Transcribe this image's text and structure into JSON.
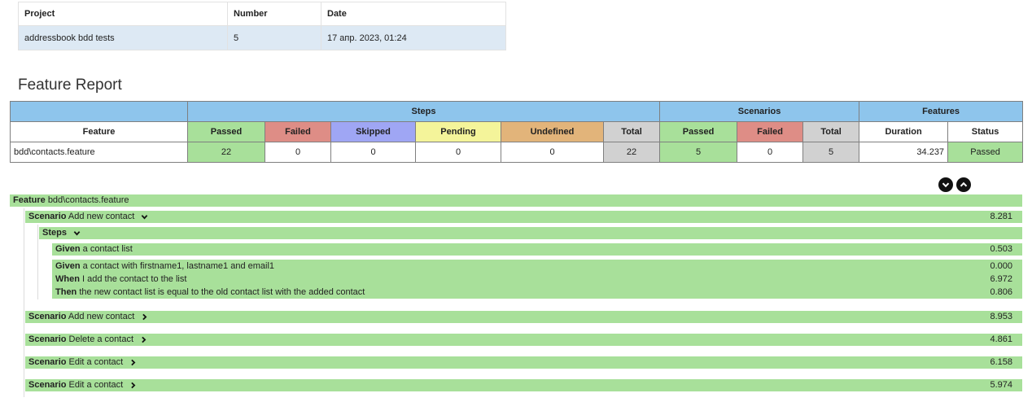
{
  "project_table": {
    "headers": [
      "Project",
      "Number",
      "Date"
    ],
    "row": [
      "addressbook bdd tests",
      "5",
      "17 апр. 2023, 01:24"
    ]
  },
  "report_title": "Feature Report",
  "stats_table": {
    "group_headers": {
      "steps": "Steps",
      "scenarios": "Scenarios",
      "features": "Features"
    },
    "columns": {
      "feature": "Feature",
      "steps_passed": "Passed",
      "steps_failed": "Failed",
      "steps_skipped": "Skipped",
      "steps_pending": "Pending",
      "steps_undefined": "Undefined",
      "steps_total": "Total",
      "sc_passed": "Passed",
      "sc_failed": "Failed",
      "sc_total": "Total",
      "duration": "Duration",
      "status": "Status"
    },
    "row": {
      "feature": "bdd\\contacts.feature",
      "steps_passed": "22",
      "steps_failed": "0",
      "steps_skipped": "0",
      "steps_pending": "0",
      "steps_undefined": "0",
      "steps_total": "22",
      "sc_passed": "5",
      "sc_failed": "0",
      "sc_total": "5",
      "duration": "34.237",
      "status": "Passed"
    }
  },
  "colors": {
    "passed": "#a8e09a",
    "failed": "#de8d86",
    "skipped": "#9fa6f4",
    "pending": "#f4f49a",
    "undefined": "#e2b47a",
    "total": "#d1d1d1",
    "header": "#8ec5ec"
  },
  "icons": {
    "expand_all": "chevron-down-circle-icon",
    "collapse_all": "chevron-up-circle-icon"
  },
  "tree": {
    "feature": {
      "keyword": "Feature",
      "name": "bdd\\contacts.feature"
    },
    "scenario_open": {
      "keyword": "Scenario",
      "name": "Add new contact",
      "duration": "8.281"
    },
    "steps_header": "Steps",
    "steps": [
      {
        "keyword": "Given",
        "text": "a contact list",
        "duration": "0.503"
      },
      {
        "keyword": "Given",
        "text": "a contact with firstname1, lastname1 and email1",
        "duration": "0.000"
      },
      {
        "keyword": "When",
        "text": "I add the contact to the list",
        "duration": "6.972"
      },
      {
        "keyword": "Then",
        "text": "the new contact list is equal to the old contact list with the added contact",
        "duration": "0.806"
      }
    ],
    "scenarios_collapsed": [
      {
        "keyword": "Scenario",
        "name": "Add new contact",
        "duration": "8.953"
      },
      {
        "keyword": "Scenario",
        "name": "Delete a contact",
        "duration": "4.861"
      },
      {
        "keyword": "Scenario",
        "name": "Edit a contact",
        "duration": "6.158"
      },
      {
        "keyword": "Scenario",
        "name": "Edit a contact",
        "duration": "5.974"
      }
    ]
  }
}
